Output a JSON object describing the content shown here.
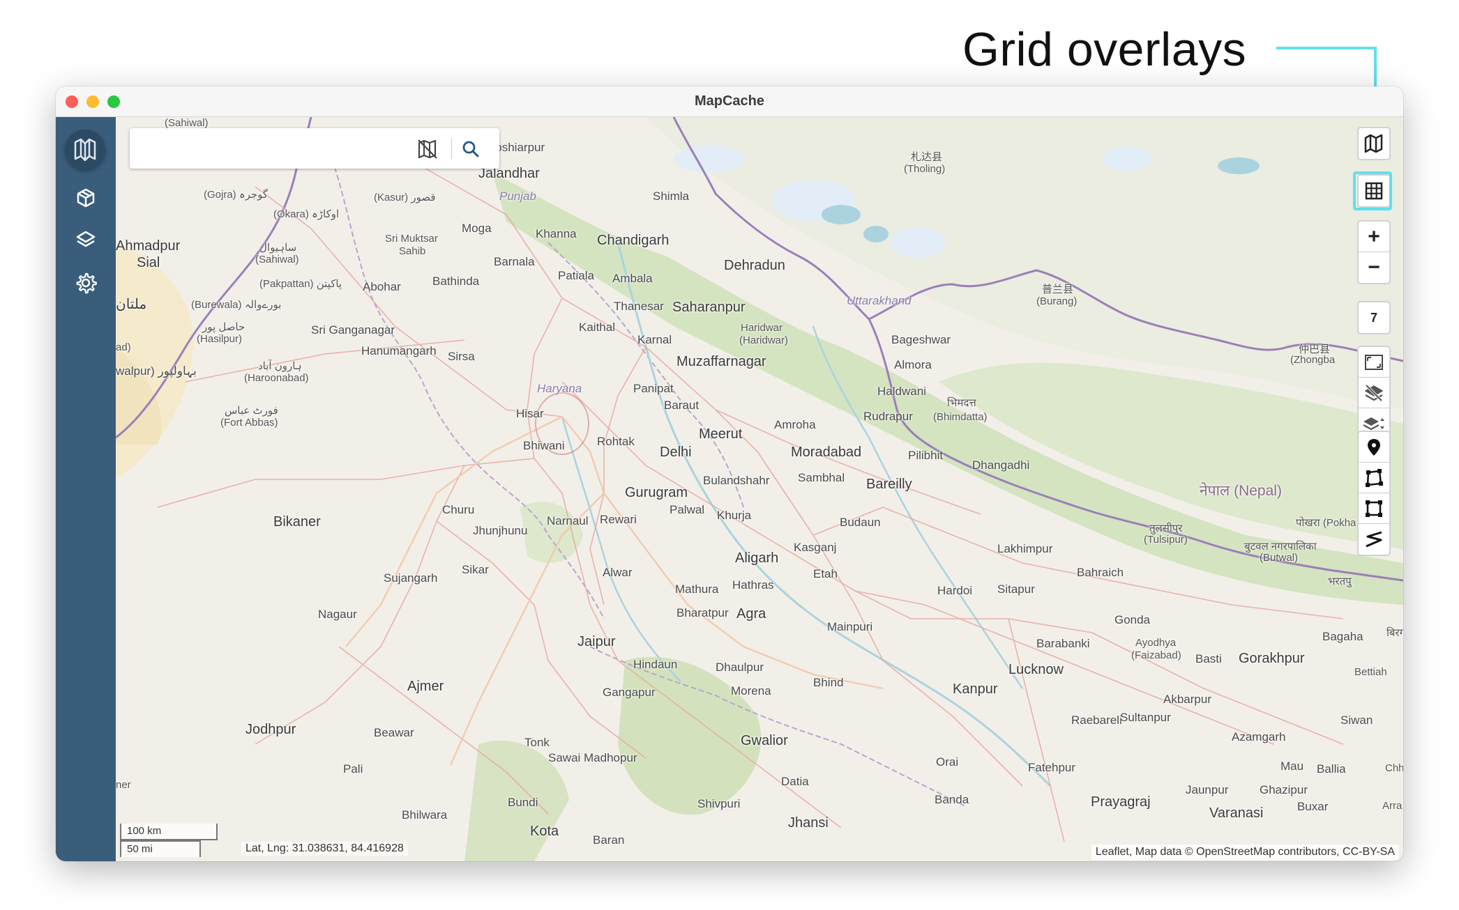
{
  "annotation": {
    "text": "Grid overlays",
    "line_color": "#5fe0f0"
  },
  "window": {
    "title": "MapCache"
  },
  "sidebar": {
    "items": [
      {
        "name": "map-logo-icon"
      },
      {
        "name": "cube-icon"
      },
      {
        "name": "layers-icon"
      },
      {
        "name": "gear-icon"
      }
    ],
    "background": "#3a5d7b"
  },
  "search": {
    "placeholder": "",
    "value": ""
  },
  "controls": {
    "zoom_in": "+",
    "zoom_out": "−",
    "zoom_level": "7",
    "icons": [
      "basemap-icon",
      "grid-icon",
      "fit-extent-icon",
      "clear-layers-icon",
      "layer-order-icon",
      "marker-icon",
      "polygon-icon",
      "rectangle-icon",
      "polyline-icon"
    ]
  },
  "map": {
    "labels": {
      "sahiwal_top": "(Sahiwal)",
      "hoshiarpur": "Hoshiarpur",
      "jalandhar": "Jalandhar",
      "punjab": "Punjab",
      "gojra": "(Gojra) گوجرہ",
      "kasur": "(Kasur) قصور",
      "okara": "(Okara) اوکاڑہ",
      "ahmadpur": "Ahmadpur",
      "sial": "Sial",
      "sahiwal": "ساہیوال",
      "sahiwal2": "(Sahiwal)",
      "moga": "Moga",
      "khanna": "Khanna",
      "sri_muktsar": "Sri Muktsar",
      "sahib": "Sahib",
      "pakpattan": "(Pakpattan) پاکپتن",
      "barnala": "Barnala",
      "bathinda": "Bathinda",
      "patiala": "Patiala",
      "ambala": "Ambala",
      "shimla": "Shimla",
      "chandigarh": "Chandigarh",
      "dehradun": "Dehradun",
      "multan": "ملتان",
      "burewala": "(Burewala) بورےوالہ",
      "abohar": "Abohar",
      "thanesar": "Thanesar",
      "saharanpur": "Saharanpur",
      "uttarakhand": "Uttarakhand",
      "hasilpur": "حاصل پور",
      "hasilpur2": "(Hasilpur)",
      "sri_ganganagar": "Sri Ganganagar",
      "kaithal": "Kaithal",
      "haridwar": "Haridwar",
      "haridwar2": "(Haridwar)",
      "bageshwar": "Bageshwar",
      "hanumangarh": "Hanumangarh",
      "sirsa": "Sirsa",
      "karnal": "Karnal",
      "haroonabad": "ہارون آباد",
      "haroonabad2": "(Haroonabad)",
      "muzaffarnagar": "Muzaffarnagar",
      "almora": "Almora",
      "bahawalpur": "walpur) بہاولپور",
      "haryana": "Haryana",
      "panipat": "Panipat",
      "haldwani": "Haldwani",
      "fort_abbas": "فورٹ عباس",
      "fort_abbas2": "(Fort Abbas)",
      "hisar": "Hisar",
      "baraut": "Baraut",
      "rudrapur": "Rudrapur",
      "bhimdatta": "भिमदत्त",
      "bhimdatta2": "(Bhimdatta)",
      "amroha": "Amroha",
      "bhiwani": "Bhiwani",
      "rohtak": "Rohtak",
      "meerut": "Meerut",
      "delhi": "Delhi",
      "moradabad": "Moradabad",
      "pilibhit": "Pilibhit",
      "dhangadhi": "Dhangadhi",
      "bulandshahr": "Bulandshahr",
      "sambhal": "Sambhal",
      "bareilly": "Bareilly",
      "gurugram": "Gurugram",
      "palwal": "Palwal",
      "churu": "Churu",
      "bikaner": "Bikaner",
      "narnaul": "Narnaul",
      "rewari": "Rewari",
      "khurja": "Khurja",
      "budaun": "Budaun",
      "jhunjhunu": "Jhunjhunu",
      "nepal": "नेपाल (Nepal)",
      "tulsipur": "तुलसीपुर",
      "tulsipur2": "(Tulsipur)",
      "pokhara": "पोखरा (Pokha",
      "aligarh": "Aligarh",
      "kasganj": "Kasganj",
      "lakhimpur": "Lakhimpur",
      "butwal": "बुटवल नगरपालिका",
      "butwal2": "(Butwal)",
      "sikar": "Sikar",
      "sujangarh": "Sujangarh",
      "alwar": "Alwar",
      "etah": "Etah",
      "hathras": "Hathras",
      "mathura": "Mathura",
      "hardoi": "Hardoi",
      "sitapur": "Sitapur",
      "bahraich": "Bahraich",
      "bharatpur_np": "भरतपु",
      "nagaur": "Nagaur",
      "bharatpur": "Bharatpur",
      "agra": "Agra",
      "gonda": "Gonda",
      "mainpuri": "Mainpuri",
      "jaipur": "Jaipur",
      "barabanki": "Barabanki",
      "ayodhya": "Ayodhya",
      "ayodhya2": "(Faizabad)",
      "basti": "Basti",
      "gorakhpur": "Gorakhpur",
      "bagaha": "Bagaha",
      "hindaun": "Hindaun",
      "dhaulpur": "Dhaulpur",
      "lucknow": "Lucknow",
      "bettiah": "Bettiah",
      "ajmer": "Ajmer",
      "gangapur": "Gangapur",
      "morena": "Morena",
      "bhind": "Bhind",
      "kanpur": "Kanpur",
      "akbarpur": "Akbarpur",
      "raebareli": "Raebareli",
      "sultanpur": "Sultanpur",
      "siwan": "Siwan",
      "jodhpur": "Jodhpur",
      "beawar": "Beawar",
      "tonk": "Tonk",
      "gwalior": "Gwalior",
      "azamgarh": "Azamgarh",
      "sawai_madhopur": "Sawai Madhopur",
      "orai": "Orai",
      "fatehpur": "Fatehpur",
      "mau": "Mau",
      "ballia": "Ballia",
      "pali": "Pali",
      "datia": "Datia",
      "jaunpur": "Jaunpur",
      "ghazipur": "Ghazipur",
      "bundi": "Bundi",
      "shivpuri": "Shivpuri",
      "banda": "Banda",
      "prayagraj": "Prayagraj",
      "buxar": "Buxar",
      "bhilwara": "Bhilwara",
      "jhansi": "Jhansi",
      "varanasi": "Varanasi",
      "kota": "Kota",
      "baran": "Baran",
      "zhada": "札达县",
      "tholing": "(Tholing)",
      "purang": "普兰县",
      "burang": "(Burang)",
      "zhongba": "仲巴县",
      "zhongba2": "(Zhongba",
      "ner": "ner",
      "ad": "ad)",
      "chh": "Chh",
      "arra": "Arra",
      "birg": "बिरगं"
    }
  },
  "scale": {
    "km": "100 km",
    "mi": "50 mi"
  },
  "coords": {
    "text": "Lat, Lng: 31.038631, 84.416928"
  },
  "attribution": "Leaflet, Map data © OpenStreetMap contributors, CC-BY-SA"
}
